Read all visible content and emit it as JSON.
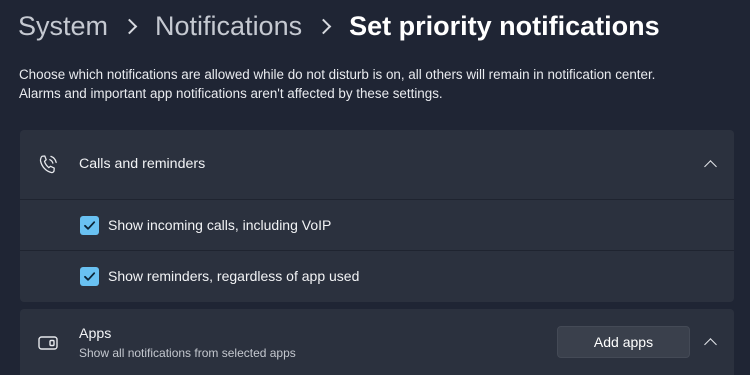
{
  "breadcrumb": {
    "items": [
      {
        "label": "System"
      },
      {
        "label": "Notifications"
      },
      {
        "label": "Set priority notifications"
      }
    ]
  },
  "description": {
    "line1": "Choose which notifications are allowed while do not disturb is on, all others will remain in notification center.",
    "line2": "Alarms and important app notifications aren't affected by these settings."
  },
  "calls_section": {
    "title": "Calls and reminders",
    "icon": "phone-ringing-icon",
    "expanded": true,
    "options": [
      {
        "label": "Show incoming calls, including VoIP",
        "checked": true
      },
      {
        "label": "Show reminders, regardless of app used",
        "checked": true
      }
    ]
  },
  "apps_section": {
    "title": "Apps",
    "subtitle": "Show all notifications from selected apps",
    "icon": "apps-window-icon",
    "button_label": "Add apps",
    "expanded": true
  },
  "colors": {
    "background": "#1f2534",
    "card": "#2b313e",
    "accent": "#69c1f2",
    "button": "#3a404c"
  }
}
